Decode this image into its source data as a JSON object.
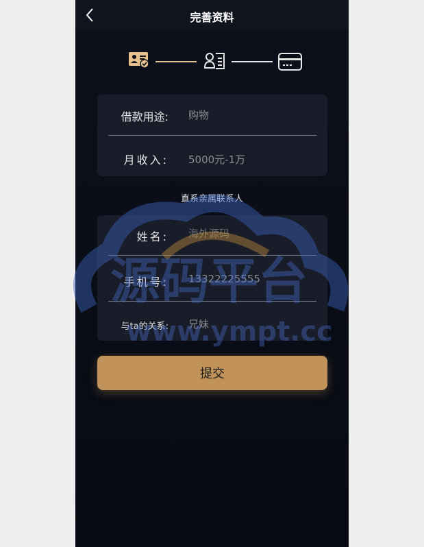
{
  "nav": {
    "title": "完善资料",
    "back_icon": "chevron-left-icon"
  },
  "steps": [
    {
      "icon": "id-card-verified-icon",
      "state": "done"
    },
    {
      "icon": "contact-card-icon",
      "state": "current"
    },
    {
      "icon": "bank-card-icon",
      "state": "pending"
    }
  ],
  "colors": {
    "accent": "#c1935a",
    "step_active": "#e7c28d",
    "card_bg": "#191d29",
    "page_bg": "#070a12"
  },
  "loan_card": {
    "purpose_label": "借款用途:",
    "purpose_value": "购物",
    "income_label": "月收入:",
    "income_value": "5000元-1万"
  },
  "contact_section_title": "直系亲属联系人",
  "contact_card": {
    "name_label": "姓名:",
    "name_placeholder": "海外源码",
    "phone_label": "手机号:",
    "phone_value": "13322225555",
    "relation_label": "与ta的关系:",
    "relation_value": "兄妹"
  },
  "submit_label": "提交",
  "watermark": {
    "title": "源码平台",
    "url": "www.ympt.cc"
  }
}
